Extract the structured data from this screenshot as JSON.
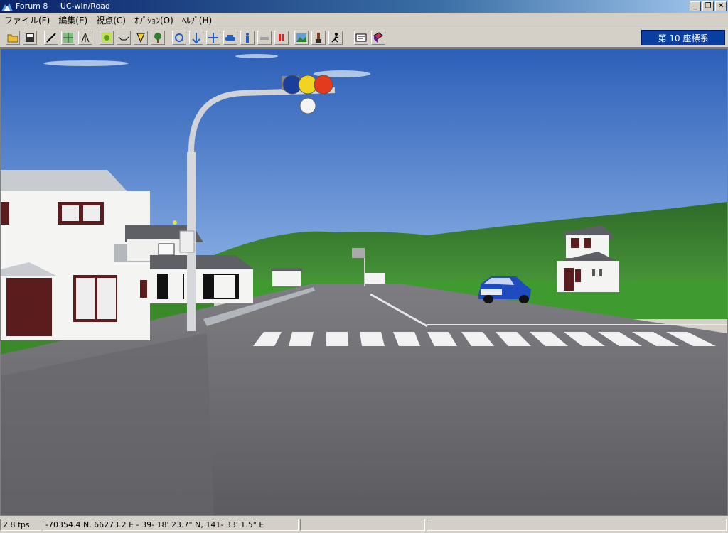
{
  "titlebar": {
    "app_name": "Forum 8",
    "product": "UC-win/Road",
    "minimize": "_",
    "restore": "❐",
    "close": "✕"
  },
  "menu": [
    {
      "label": "ファイル(F)"
    },
    {
      "label": "編集(E)"
    },
    {
      "label": "視点(C)"
    },
    {
      "label": "ｵﾌﾟｼｮﾝ(O)"
    },
    {
      "label": "ﾍﾙﾌﾟ(H)"
    }
  ],
  "toolbar": {
    "coordinate_system": "第 10 座標系",
    "buttons": [
      {
        "icon": "open-folder-icon"
      },
      {
        "icon": "save-icon"
      },
      {
        "icon": "road-edit-icon"
      },
      {
        "icon": "network-icon"
      },
      {
        "icon": "road-section-icon"
      },
      {
        "icon": "terrain-icon"
      },
      {
        "icon": "cross-section-icon"
      },
      {
        "icon": "signal-icon"
      },
      {
        "icon": "tree-icon"
      },
      {
        "icon": "rotate-view-icon"
      },
      {
        "icon": "pan-view-icon"
      },
      {
        "icon": "move-view-icon"
      },
      {
        "icon": "drive-car-icon"
      },
      {
        "icon": "walk-person-icon"
      },
      {
        "icon": "fly-icon"
      },
      {
        "icon": "pause-icon"
      },
      {
        "icon": "landscape-icon"
      },
      {
        "icon": "brush-icon"
      },
      {
        "icon": "run-icon"
      },
      {
        "icon": "screen-icon"
      },
      {
        "icon": "book-icon"
      }
    ]
  },
  "status": {
    "fps": "2.8 fps",
    "coordinates": "-70354.4 N, 66273.2 E  -  39- 18' 23.7\" N, 141- 33' 1.5\" E",
    "empty1": "",
    "empty2": ""
  },
  "colors": {
    "sky_top": "#2c5fb8",
    "sky_bottom": "#8fb3e6",
    "asphalt": "#6a6a70",
    "grass": "#3a8a2a",
    "title_bar": "#0a246a"
  }
}
